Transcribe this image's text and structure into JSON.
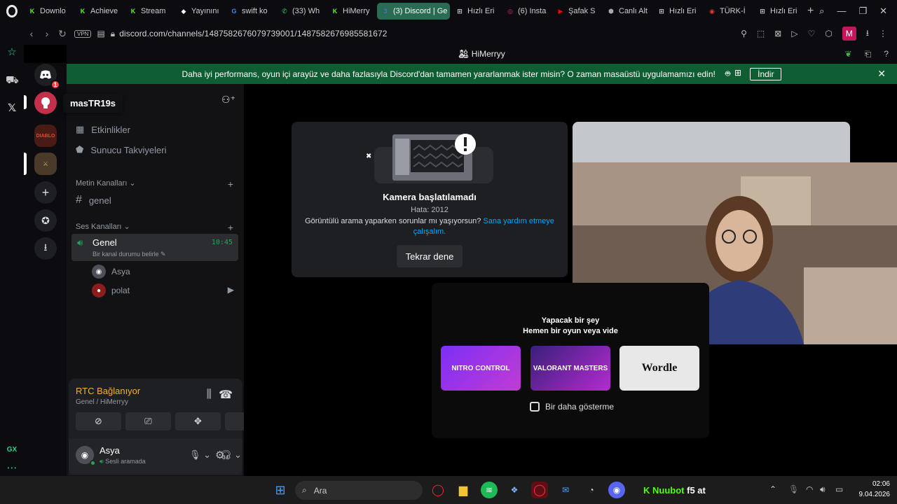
{
  "browser": {
    "tabs": [
      {
        "label": "Downlo",
        "icon": "kick-icon",
        "color": "#53fc18",
        "glyph": "K"
      },
      {
        "label": "Achieve",
        "icon": "kick-icon",
        "color": "#53fc18",
        "glyph": "K"
      },
      {
        "label": "Stream",
        "icon": "kick-icon",
        "color": "#53fc18",
        "glyph": "K"
      },
      {
        "label": "Yayınını",
        "icon": "app-icon",
        "color": "#ffffff",
        "glyph": "◆"
      },
      {
        "label": "swift ko",
        "icon": "google-icon",
        "color": "#4285f4",
        "glyph": "G"
      },
      {
        "label": "(33) Wh",
        "icon": "whatsapp-icon",
        "color": "#25d366",
        "glyph": "✆"
      },
      {
        "label": "HiMerry",
        "icon": "kick-icon",
        "color": "#53fc18",
        "glyph": "K"
      },
      {
        "label": "(3) Discord | Ge",
        "icon": "discord-icon",
        "color": "#5865f2",
        "glyph": "3"
      },
      {
        "label": "Hızlı Eri",
        "icon": "grid-icon",
        "color": "#cccccc",
        "glyph": "⊞"
      },
      {
        "label": "(6) Insta",
        "icon": "instagram-icon",
        "color": "#e1306c",
        "glyph": "◎"
      },
      {
        "label": "Şafak S",
        "icon": "youtube-icon",
        "color": "#ff0000",
        "glyph": "▶"
      },
      {
        "label": "Canlı Alt",
        "icon": "web-icon",
        "color": "#aaaaaa",
        "glyph": "⬢"
      },
      {
        "label": "Hızlı Eri",
        "icon": "grid-icon",
        "color": "#cccccc",
        "glyph": "⊞"
      },
      {
        "label": "TÜRK-İ",
        "icon": "web-icon",
        "color": "#e53935",
        "glyph": "◉"
      },
      {
        "label": "Hızlı Eri",
        "icon": "grid-icon",
        "color": "#cccccc",
        "glyph": "⊞"
      }
    ],
    "active_tab_index": 7,
    "vpn_label": "VPN",
    "url": "discord.com/channels/1487582676079739001/1487582676985581672",
    "profile_letter": "M",
    "page_title": "HiMerryy",
    "opera_side_label": "GX"
  },
  "banner": {
    "text": "Daha iyi performans, oyun içi arayüz ve daha fazlasıyla Discord'dan tamamen yararlanmak ister misin? O zaman masaüstü uygulamamızı edin!",
    "button": "İndir"
  },
  "rail": {
    "home_badge": "1",
    "tooltip": "masTR19s"
  },
  "channels": {
    "events": "Etkinlikler",
    "boosts": "Sunucu Takviyeleri",
    "text_category": "Metin Kanalları",
    "text_channel": "genel",
    "voice_category": "Ses Kanalları",
    "voice_channel": "Genel",
    "voice_timer": "10:45",
    "voice_status": "Bir kanal durumu belirle",
    "members": [
      "Asya",
      "polat"
    ]
  },
  "rtc": {
    "title": "RTC Bağlanıyor",
    "subtitle": "Genel / HiMerryy"
  },
  "user": {
    "name": "Asya",
    "status": "Sesli aramada"
  },
  "camera_error": {
    "title": "Kamera başlatılamadı",
    "code": "Hata: 2012",
    "help_text": "Görüntülü arama yaparken sorunlar mı yaşıyorsun?",
    "help_link": "Sana yardım etmeye çalışalım.",
    "retry": "Tekrar dene"
  },
  "activity": {
    "line1": "Yapacak bir şey",
    "line2": "Hemen bir oyun veya vide",
    "games": [
      "NITRO CONTROL",
      "VALORANT MASTERS",
      "Wordle"
    ],
    "dont_show": "Bir daha gösterme"
  },
  "taskbar": {
    "search_placeholder": "Ara",
    "kick_label": "Nuubot",
    "kick_text": "f5 at",
    "time": "02:06",
    "date": "9.04.2026"
  },
  "colors": {
    "banner_green": "#0f5d33",
    "active_tab": "#2a6b53",
    "rtc_warning": "#f0b232",
    "link": "#00a8fc",
    "kick_green": "#53fc18"
  }
}
